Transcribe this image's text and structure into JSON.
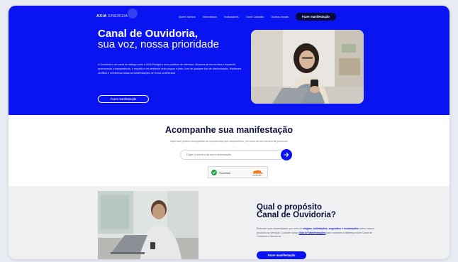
{
  "hero": {
    "logo_bold": "AXIA",
    "logo_light": "ENERGIA",
    "nav": [
      "Quem somos",
      "Normativos",
      "Indicadores",
      "Ouvir Cidadão",
      "Outros canais"
    ],
    "nav_cta": "Fazer manifestação",
    "title_bold": "Canal de Ouvidoria",
    "title_punct": ",",
    "subtitle": "sua voz, nossa prioridade",
    "description": "A Ouvidoria é um canal de diálogo entre a AXIA Energia e seus públicos de interesse. Atuamos de forma ética e imparcial, promovendo a transparência, o respeito e um ambiente mais seguro e justo, livre de qualquer tipo de discriminação. Mediamos conflitos e recebemos todas as manifestações de forma confidencial.",
    "button": "Fazer manifestação"
  },
  "tracking": {
    "title_bold": "Acompanhe",
    "title_rest": " sua manifestação",
    "description": "Aqui você poderá acompanhar as experiências que compartilhou, por meio do seu número de protocolo",
    "input_placeholder": "Digite o número da sua manifestação",
    "captcha_label": "Success!",
    "captcha_brand": "CLOUDFLARE"
  },
  "purpose": {
    "title_line1": "Qual o propósito",
    "title_line2": "Canal de Ouvidoria",
    "title_punct": "?",
    "desc_1": "Entender suas necessidades por meio de ",
    "desc_2": "elogios, solicitações, sugestões e reclamações",
    "desc_3": " sobre nossos produtos ou serviços. Consulte nosso ",
    "desc_4": "Guia de Manifestações",
    "desc_5": " para conhecer a diferença entre Canal de Ouvidoria e Denúncia.",
    "button": "Fazer manifestação"
  },
  "colors": {
    "brand_blue": "#0a14f0",
    "dark_navy": "#050a3a",
    "success_green": "#1ea446"
  }
}
